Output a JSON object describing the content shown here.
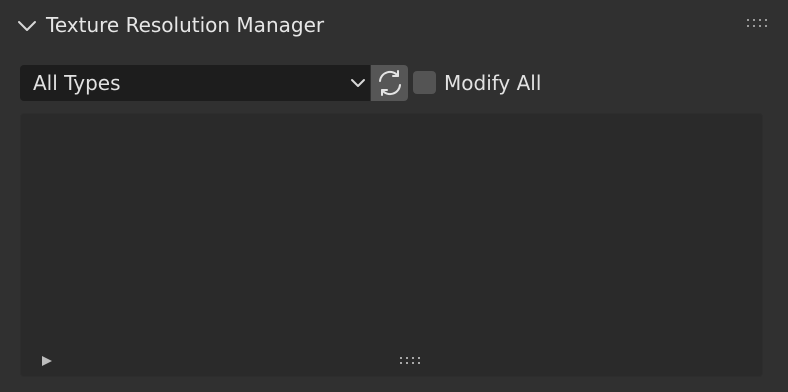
{
  "panel": {
    "title": "Texture Resolution Manager",
    "collapse_icon": "chevron-down-icon",
    "drag_icon": "drag-grip-icon"
  },
  "controls": {
    "type_filter": {
      "selected": "All Types",
      "icon": "chevron-down-icon"
    },
    "refresh_icon": "refresh-icon",
    "modify_all": {
      "label": "Modify All",
      "checked": false
    }
  },
  "list": {
    "items": [],
    "filter_toggle_icon": "triangle-right-icon",
    "resize_icon": "resize-grip-icon"
  },
  "colors": {
    "panel_bg": "#303030",
    "list_bg": "#2a2a2a",
    "field_bg": "#1d1d1d",
    "button_bg": "#565656",
    "text": "#e6e6e6"
  }
}
